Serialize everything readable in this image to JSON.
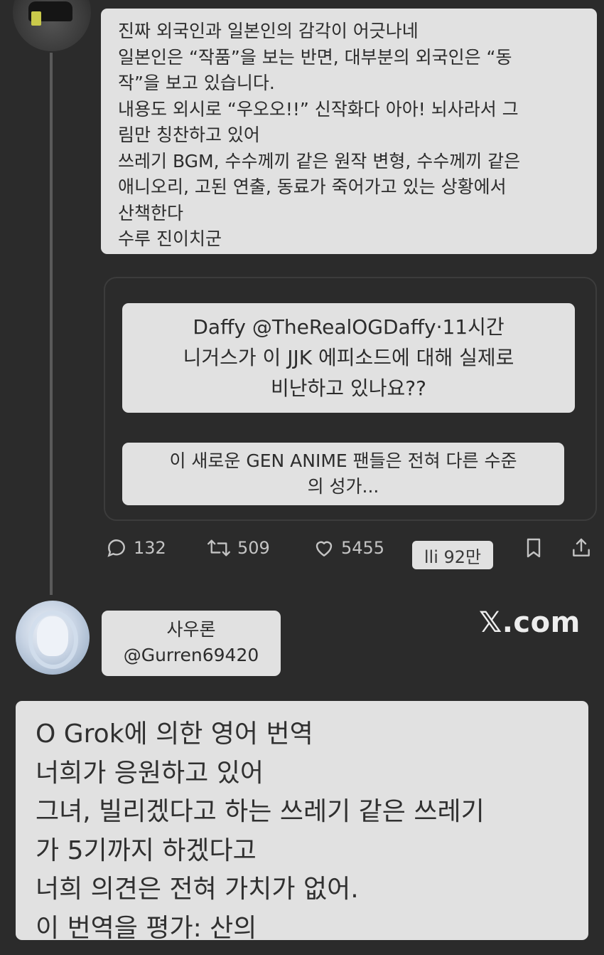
{
  "tweet": {
    "lines": [
      "진짜 외국인과 일본인의 감각이 어긋나네",
      "일본인은 “작품”을 보는 반면, 대부분의 외국인은 “동",
      "작”을 보고 있습니다.",
      "내용도 외시로 “우오오!!” 신작화다 아아! 뇌사라서 그",
      "림만 칭찬하고 있어",
      "쓰레기 BGM, 수수께끼 같은 원작 변형, 수수께끼 같은",
      "애니오리, 고된 연출, 동료가 죽어가고 있는 상황에서",
      "산책한다",
      "수루 진이치군"
    ]
  },
  "quote": {
    "header_lines": [
      "Daffy @TheRealOGDaffy·11시간",
      "니거스가 이 JJK 에피소드에 대해 실제로",
      "비난하고 있나요??"
    ],
    "body_lines": [
      "이 새로운 GEN ANIME 팬들은 전혀 다른 수준",
      "의 성가..."
    ]
  },
  "actions": {
    "replies": "132",
    "reposts": "509",
    "likes": "5455",
    "views": "lli 92만"
  },
  "reply_author": {
    "name": "사우론",
    "handle": "@Gurren69420"
  },
  "watermark": "𝕏.com",
  "translation": {
    "lines": [
      "O Grok에 의한 영어 번역",
      "너희가 응원하고 있어",
      "그녀, 빌리겠다고 하는 쓰레기 같은 쓰레기",
      "가 5기까지 하겠다고",
      "너희 의견은 전혀 가치가 없어.",
      "이 번역을 평가: 산의"
    ]
  },
  "colors": {
    "background": "#2b2b2b",
    "overlay": "#e1e1e1",
    "text": "#2c2c2c",
    "icon": "#c4c4c4"
  }
}
